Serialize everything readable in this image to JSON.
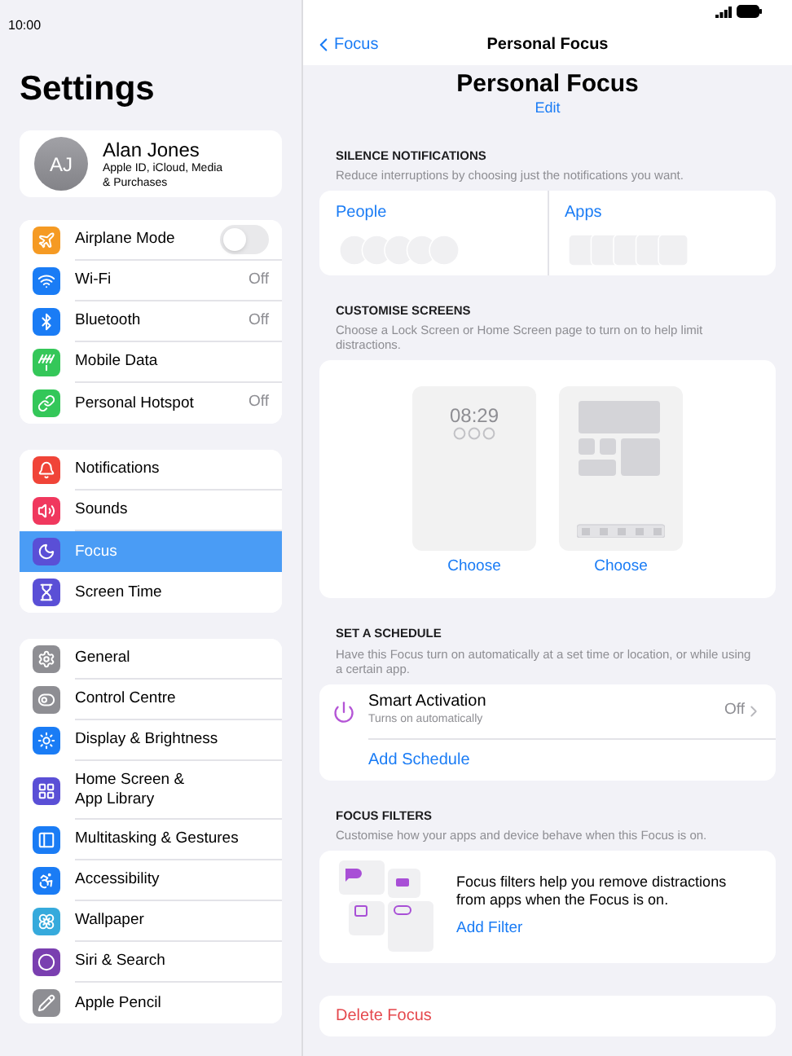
{
  "status_bar": {
    "time": "10:00"
  },
  "sidebar": {
    "title": "Settings",
    "profile": {
      "initials": "AJ",
      "name": "Alan Jones",
      "subtitle": "Apple ID, iCloud, Media & Purchases"
    },
    "groups": [
      [
        {
          "label": "Airplane Mode",
          "kind": "toggle",
          "on": false,
          "selected": false
        },
        {
          "label": "Wi-Fi",
          "kind": "value",
          "value": "Off",
          "selected": false
        },
        {
          "label": "Bluetooth",
          "kind": "value",
          "value": "Off",
          "selected": false
        },
        {
          "label": "Mobile Data",
          "kind": "plain",
          "selected": false
        },
        {
          "label": "Personal Hotspot",
          "kind": "value",
          "value": "Off",
          "selected": false
        }
      ],
      [
        {
          "label": "Notifications",
          "kind": "plain",
          "selected": false
        },
        {
          "label": "Sounds",
          "kind": "plain",
          "selected": false
        },
        {
          "label": "Focus",
          "kind": "plain",
          "selected": true
        },
        {
          "label": "Screen Time",
          "kind": "plain",
          "selected": false
        }
      ],
      [
        {
          "label": "General",
          "kind": "plain",
          "selected": false
        },
        {
          "label": "Control Centre",
          "kind": "plain",
          "selected": false
        },
        {
          "label": "Display & Brightness",
          "kind": "plain",
          "selected": false
        },
        {
          "label": "Home Screen & App Library",
          "kind": "plain",
          "selected": false
        },
        {
          "label": "Multitasking & Gestures",
          "kind": "plain",
          "selected": false
        },
        {
          "label": "Accessibility",
          "kind": "plain",
          "selected": false
        },
        {
          "label": "Wallpaper",
          "kind": "plain",
          "selected": false
        },
        {
          "label": "Siri & Search",
          "kind": "plain",
          "selected": false
        },
        {
          "label": "Apple Pencil",
          "kind": "plain",
          "selected": false
        }
      ]
    ]
  },
  "detail": {
    "nav": {
      "back": "Focus",
      "title": "Personal Focus"
    },
    "header": {
      "title": "Personal Focus",
      "edit": "Edit"
    },
    "silence": {
      "heading": "SILENCE NOTIFICATIONS",
      "description": "Reduce interruptions by choosing just the notifications you want.",
      "people": "People",
      "apps": "Apps"
    },
    "customise": {
      "heading": "CUSTOMISE SCREENS",
      "description": "Choose a Lock Screen or Home Screen page to turn on to help limit distractions.",
      "lock_time": "08:29",
      "choose": [
        "Choose",
        "Choose"
      ]
    },
    "schedule": {
      "heading": "SET A SCHEDULE",
      "description": "Have this Focus turn on automatically at a set time or location, or while using a certain app.",
      "smart_title": "Smart Activation",
      "smart_subtitle": "Turns on automatically",
      "smart_value": "Off",
      "add": "Add Schedule"
    },
    "filters": {
      "heading": "FOCUS FILTERS",
      "description": "Customise how your apps and device behave when this Focus is on.",
      "text": "Focus filters help you remove distractions from apps when the Focus is on.",
      "add": "Add Filter"
    },
    "delete": "Delete Focus"
  }
}
